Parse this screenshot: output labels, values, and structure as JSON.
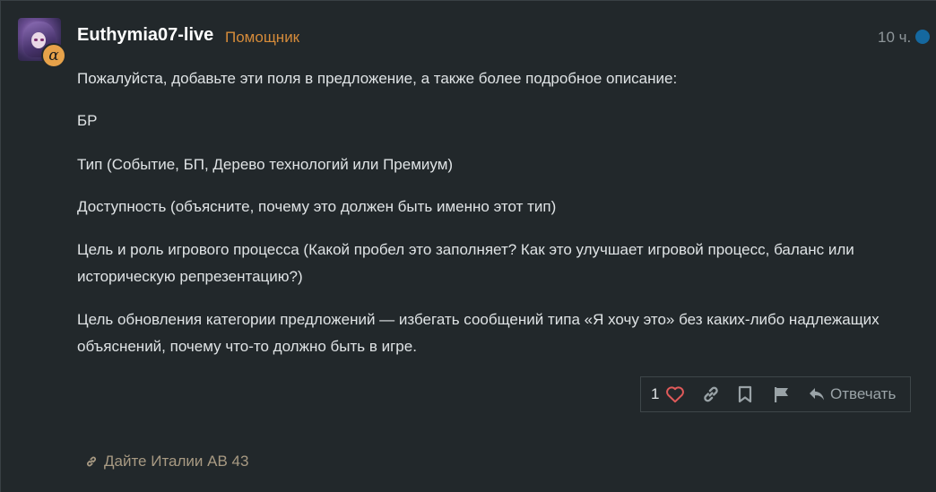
{
  "post": {
    "username": "Euthymia07-live",
    "user_title": "Помощник",
    "date": "10 ч.",
    "flair_symbol": "α",
    "paragraphs": [
      "Пожалуйста, добавьте эти поля в предложение, а также более подробное описание:",
      "БР",
      "Тип (Событие, БП, Дерево технологий или Премиум)",
      "Доступность (объясните, почему это должен быть именно этот тип)",
      "Цель и роль игрового процесса (Какой пробел это заполняет? Как это улучшает игровой процесс, баланс или историческую репрезентацию?)",
      "Цель обновления категории предложений — избегать сообщений типа «Я хочу это» без каких-либо надлежащих объяснений, почему что-то должно быть в игре."
    ]
  },
  "actions": {
    "like_count": "1",
    "reply_label": "Отвечать",
    "icons": [
      "heart-icon",
      "link-icon",
      "bookmark-icon",
      "flag-icon",
      "reply-icon"
    ]
  },
  "linked_topic": {
    "title": "Дайте Италии AB 43"
  },
  "colors": {
    "background": "#22282b",
    "user_title": "#d58b3a",
    "unread_dot": "#15689f",
    "heart": "#e05a5a",
    "muted": "#9aa3a7"
  }
}
